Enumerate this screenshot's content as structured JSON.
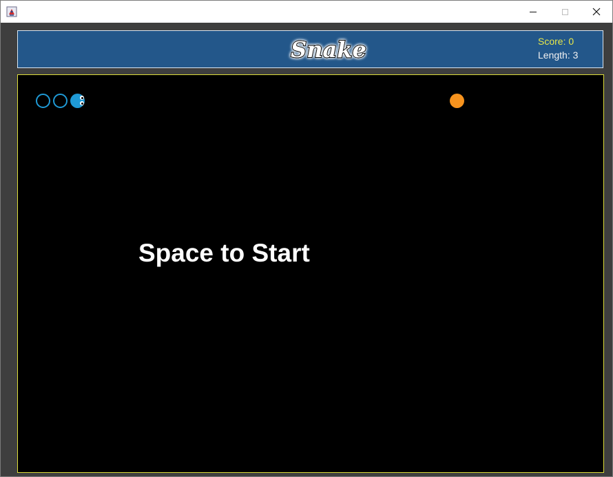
{
  "window": {
    "app_icon": "java-cup-icon",
    "controls": {
      "minimize_icon": "minimize-icon",
      "maximize_icon": "maximize-icon",
      "close_icon": "close-icon"
    }
  },
  "header": {
    "title": "Snake",
    "score_label": "Score: 0",
    "length_label": "Length: 3"
  },
  "game": {
    "score": 0,
    "length": 3,
    "prompt": "Space to Start",
    "snake_direction": "right",
    "snake_segments": 3,
    "food_icon": "food-orb-icon"
  },
  "colors": {
    "window_bg": "#3e3e3e",
    "header_bg": "#23578a",
    "board_bg": "#000000",
    "board_border": "#dede3a",
    "snake": "#1f9ad6",
    "food": "#f7931e",
    "score_text": "#e8e84a",
    "length_text": "#f2f2f2"
  }
}
